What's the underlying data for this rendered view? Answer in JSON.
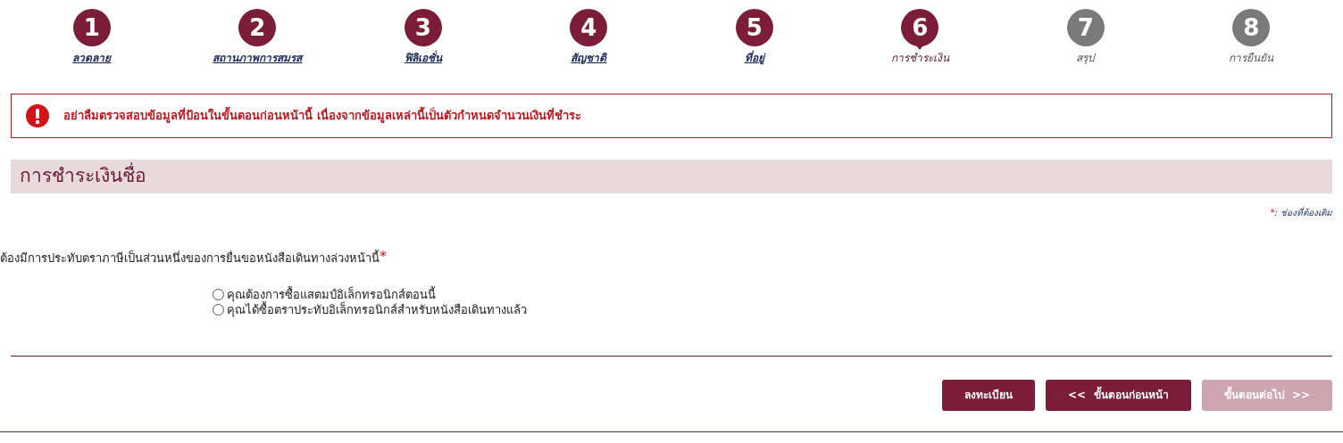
{
  "steps": [
    {
      "number": "1",
      "label": "ลวดลาย",
      "completed": true,
      "selected": false
    },
    {
      "number": "2",
      "label": "สถานภาพการสมรส",
      "completed": true,
      "selected": false
    },
    {
      "number": "3",
      "label": "ฟิลิเอชั่น",
      "completed": true,
      "selected": false
    },
    {
      "number": "4",
      "label": "สัญชาติ",
      "completed": true,
      "selected": false
    },
    {
      "number": "5",
      "label": "ที่อยู่",
      "completed": true,
      "selected": false
    },
    {
      "number": "6",
      "label": "การชำระเงิน",
      "completed": false,
      "selected": true
    },
    {
      "number": "7",
      "label": "สรุป",
      "completed": false,
      "selected": false
    },
    {
      "number": "8",
      "label": "การยืนยัน",
      "completed": false,
      "selected": false
    }
  ],
  "alert": {
    "text": "อย่าลืมตรวจสอบข้อมูลที่ป้อนในขั้นตอนก่อนหน้านี้ เนื่องจากข้อมูลเหล่านี้เป็นตัวกำหนดจำนวนเงินที่ชำระ"
  },
  "section_title": "การชำระเงินชื่อ",
  "required_note": {
    "mark": "*",
    "text": ": ช่องที่ต้องเติม"
  },
  "question": {
    "text": "ต้องมีการประทับตราภาษีเป็นส่วนหนึ่งของการยื่นขอหนังสือเดินทางล่วงหน้านี้",
    "required_mark": "*"
  },
  "options": [
    {
      "label": "คุณต้องการซื้อแสตมป์อิเล็กทรอนิกส์ตอนนี้",
      "selected": false
    },
    {
      "label": "คุณได้ซื้อตราประทับอิเล็กทรอนิกส์สำหรับหนังสือเดินทางแล้ว",
      "selected": false
    }
  ],
  "buttons": [
    {
      "label": "ลงทะเบียน",
      "disabled": false
    },
    {
      "label": "<<  ขั้นตอนก่อนหน้า",
      "disabled": false
    },
    {
      "label": "ขั้นตอนต่อไป  >>",
      "disabled": true
    }
  ]
}
